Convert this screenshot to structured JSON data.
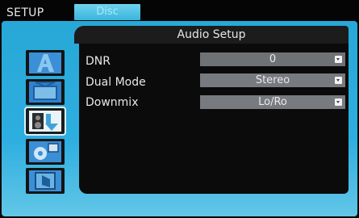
{
  "topbar": {
    "title": "SETUP",
    "tab": "Disc"
  },
  "page": {
    "heading": "Audio Setup"
  },
  "sidebar": {
    "items": [
      {
        "icon": "language-icon"
      },
      {
        "icon": "video-icon"
      },
      {
        "icon": "audio-icon",
        "selected": true
      },
      {
        "icon": "system-settings-icon"
      },
      {
        "icon": "exit-icon"
      }
    ]
  },
  "settings": [
    {
      "label": "DNR",
      "value": "0"
    },
    {
      "label": "Dual Mode",
      "value": "Stereo"
    },
    {
      "label": "Downmix",
      "value": "Lo/Ro"
    }
  ],
  "colors": {
    "panel": "#2daee0",
    "tab": "#4cc0e4",
    "value_box": "#777a7e"
  }
}
